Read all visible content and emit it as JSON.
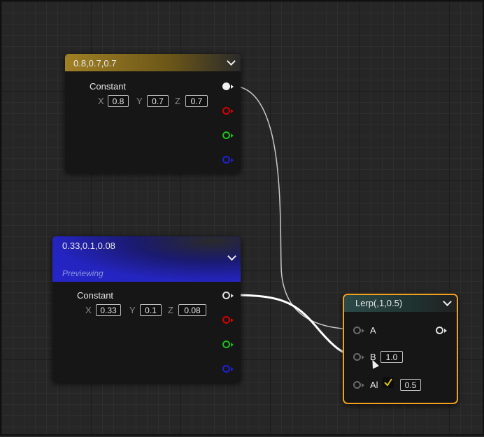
{
  "nodes": {
    "constant_1": {
      "title": "0.8,0.7,0.7",
      "label": "Constant",
      "x_axis": "X",
      "x_value": "0.8",
      "y_axis": "Y",
      "y_value": "0.7",
      "z_axis": "Z",
      "z_value": "0.7"
    },
    "constant_2": {
      "title": "0.33,0.1,0.08",
      "subtitle": "Previewing",
      "label": "Constant",
      "x_axis": "X",
      "x_value": "0.33",
      "y_axis": "Y",
      "y_value": "0.1",
      "z_axis": "Z",
      "z_value": "0.08"
    },
    "lerp": {
      "title": "Lerp(,1,0.5)",
      "input_a": "A",
      "input_b": "B",
      "input_b_value": "1.0",
      "input_alpha": "Al",
      "input_alpha_value": "0.5"
    }
  },
  "colors": {
    "constant_1_header": "#a08024",
    "constant_2_header": "#2020b8",
    "lerp_border": "#f0a020"
  }
}
